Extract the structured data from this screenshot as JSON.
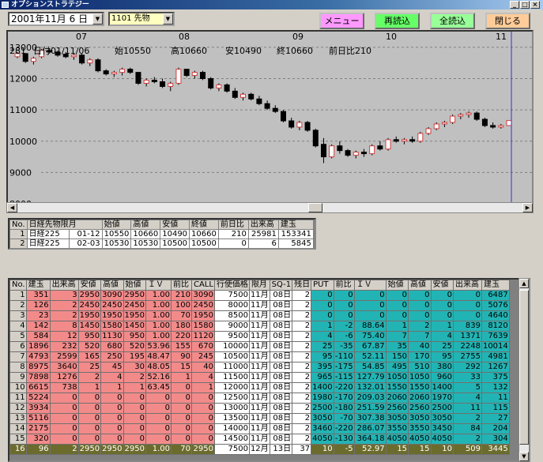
{
  "window": {
    "title": "オプションストラテジー",
    "min": "_",
    "max": "□",
    "close": "×"
  },
  "toolbar": {
    "date": "2001年11月 6 日",
    "instrument": "1101 先物",
    "buttons": [
      {
        "label": "メニュー",
        "color": "#ff99ff"
      },
      {
        "label": "再読込",
        "color": "#66ff66"
      },
      {
        "label": "全読込",
        "color": "#99ff99"
      },
      {
        "label": "閉じる",
        "color": "#ffcc99"
      }
    ]
  },
  "chart": {
    "x_ticks": [
      "07",
      "08",
      "09",
      "10",
      "11"
    ],
    "info": {
      "code": "281",
      "date": "日付01/11/06",
      "open": "始10550",
      "high": "高10660",
      "low": "安10490",
      "close": "終10660",
      "change": "前日比210"
    },
    "y_ticks": [
      "13000",
      "12000",
      "11000",
      "10000",
      "9000",
      "8000"
    ],
    "colors": {
      "up": "#ffffff",
      "down": "#000000",
      "grid": "#808080",
      "cursor": "#3333cc"
    }
  },
  "chart_data": {
    "type": "candlestick",
    "ylim": [
      8000,
      13200
    ],
    "x_ticks": [
      "07",
      "08",
      "09",
      "10",
      "11"
    ],
    "y_ticks": [
      13000,
      12000,
      11000,
      10000,
      9000,
      8000
    ],
    "candles": [
      [
        12700,
        12850,
        12650,
        12800
      ],
      [
        12800,
        12800,
        12500,
        12550
      ],
      [
        12550,
        12700,
        12450,
        12650
      ],
      [
        12700,
        12950,
        12650,
        12900
      ],
      [
        12900,
        12950,
        12800,
        12850
      ],
      [
        12850,
        12900,
        12700,
        12750
      ],
      [
        12780,
        12850,
        12650,
        12700
      ],
      [
        12700,
        12800,
        12600,
        12750
      ],
      [
        12750,
        12800,
        12450,
        12500
      ],
      [
        12500,
        12650,
        12400,
        12600
      ],
      [
        12600,
        12650,
        12200,
        12250
      ],
      [
        12250,
        12300,
        12100,
        12150
      ],
      [
        12150,
        12250,
        12050,
        12200
      ],
      [
        12200,
        12350,
        12100,
        12300
      ],
      [
        12300,
        12350,
        12150,
        12200
      ],
      [
        12200,
        12200,
        11800,
        11850
      ],
      [
        11850,
        12000,
        11750,
        11950
      ],
      [
        11950,
        12050,
        11850,
        11900
      ],
      [
        11900,
        12000,
        11700,
        11750
      ],
      [
        11750,
        11900,
        11600,
        11850
      ],
      [
        11850,
        12350,
        11800,
        12300
      ],
      [
        12300,
        12300,
        12050,
        12100
      ],
      [
        12100,
        12250,
        12000,
        12200
      ],
      [
        12200,
        12250,
        11950,
        12000
      ],
      [
        12000,
        12050,
        11650,
        11700
      ],
      [
        11700,
        11850,
        11600,
        11800
      ],
      [
        11800,
        11850,
        11550,
        11600
      ],
      [
        11600,
        11700,
        11350,
        11400
      ],
      [
        11400,
        11550,
        11300,
        11500
      ],
      [
        11500,
        11550,
        11300,
        11350
      ],
      [
        11350,
        11450,
        11150,
        11200
      ],
      [
        11200,
        11300,
        11000,
        11050
      ],
      [
        11050,
        11150,
        10900,
        10950
      ],
      [
        10950,
        11000,
        10600,
        10650
      ],
      [
        10650,
        10750,
        10400,
        10450
      ],
      [
        10450,
        10650,
        10350,
        10600
      ],
      [
        10600,
        10650,
        10300,
        10350
      ],
      [
        10350,
        10400,
        9800,
        9850
      ],
      [
        9900,
        10100,
        9300,
        9500
      ],
      [
        9500,
        9900,
        9450,
        9850
      ],
      [
        9850,
        10000,
        9600,
        9700
      ],
      [
        9700,
        9750,
        9500,
        9550
      ],
      [
        9550,
        9700,
        9450,
        9650
      ],
      [
        9650,
        9750,
        9500,
        9600
      ],
      [
        9600,
        9900,
        9550,
        9850
      ],
      [
        9850,
        10000,
        9700,
        9750
      ],
      [
        9750,
        10100,
        9700,
        10050
      ],
      [
        10050,
        10150,
        9950,
        10000
      ],
      [
        10000,
        10100,
        9900,
        10050
      ],
      [
        10050,
        10150,
        9950,
        10000
      ],
      [
        10000,
        10300,
        9950,
        10250
      ],
      [
        10250,
        10450,
        10200,
        10400
      ],
      [
        10400,
        10600,
        10350,
        10550
      ],
      [
        10550,
        10650,
        10450,
        10600
      ],
      [
        10600,
        10850,
        10550,
        10800
      ],
      [
        10800,
        10900,
        10700,
        10850
      ],
      [
        10850,
        10950,
        10750,
        10900
      ],
      [
        10900,
        10950,
        10650,
        10700
      ],
      [
        10700,
        10750,
        10450,
        10500
      ],
      [
        10500,
        10600,
        10400,
        10450
      ],
      [
        10450,
        10550,
        10400,
        10500
      ],
      [
        10500,
        10660,
        10490,
        10660
      ]
    ],
    "series": [
      {
        "name": "日経225先物",
        "values": []
      }
    ]
  },
  "futures": {
    "headers": [
      "No.",
      "日経先物限月",
      "始値",
      "高値",
      "安値",
      "終値",
      "前日比",
      "出来高",
      "建玉"
    ],
    "rows": [
      [
        "1",
        "日経225",
        "01-12",
        "10550",
        "10660",
        "10490",
        "10660",
        "210",
        "25981",
        "153341"
      ],
      [
        "2",
        "日経225",
        "02-03",
        "10530",
        "10530",
        "10500",
        "10500",
        "0",
        "6",
        "5845"
      ]
    ]
  },
  "options": {
    "headers": [
      "No.",
      "建玉",
      "出来高",
      "安値",
      "高値",
      "始値",
      "ＩＶ",
      "前比",
      "CALL",
      "行使価格",
      "限月",
      "SQ-1",
      "残日",
      "PUT",
      "前比",
      "ＩＶ",
      "始値",
      "高値",
      "安値",
      "出来高",
      "建玉"
    ],
    "rows": [
      [
        "1",
        "351",
        "3",
        "2950",
        "3090",
        "2950",
        "1.00",
        "210",
        "3090",
        "7500",
        "11月",
        "08日",
        "2",
        "0",
        "0",
        "0",
        "0",
        "0",
        "0",
        "0",
        "6487"
      ],
      [
        "2",
        "126",
        "2",
        "2450",
        "2450",
        "2450",
        "1.00",
        "100",
        "2450",
        "8000",
        "11月",
        "08日",
        "2",
        "0",
        "0",
        "0",
        "0",
        "0",
        "0",
        "0",
        "5076"
      ],
      [
        "3",
        "23",
        "2",
        "1950",
        "1950",
        "1950",
        "1.00",
        "70",
        "1950",
        "8500",
        "11月",
        "08日",
        "2",
        "0",
        "0",
        "0",
        "0",
        "0",
        "0",
        "0",
        "4640"
      ],
      [
        "4",
        "142",
        "8",
        "1450",
        "1580",
        "1450",
        "1.00",
        "180",
        "1580",
        "9000",
        "11月",
        "08日",
        "2",
        "1",
        "-2",
        "88.64",
        "1",
        "2",
        "1",
        "839",
        "8120"
      ],
      [
        "5",
        "584",
        "12",
        "950",
        "1130",
        "950",
        "1.00",
        "220",
        "1120",
        "9500",
        "11月",
        "08日",
        "2",
        "4",
        "-6",
        "75.40",
        "7",
        "7",
        "4",
        "1371",
        "7639"
      ],
      [
        "6",
        "1896",
        "232",
        "520",
        "680",
        "520",
        "53.96",
        "155",
        "670",
        "10000",
        "11月",
        "08日",
        "2",
        "25",
        "-35",
        "67.87",
        "35",
        "40",
        "25",
        "2248",
        "10014"
      ],
      [
        "7",
        "4793",
        "2599",
        "165",
        "250",
        "195",
        "48.47",
        "90",
        "245",
        "10500",
        "11月",
        "08日",
        "2",
        "95",
        "-110",
        "52.11",
        "150",
        "170",
        "95",
        "2755",
        "4981"
      ],
      [
        "8",
        "8975",
        "3640",
        "25",
        "45",
        "30",
        "48.05",
        "15",
        "40",
        "11000",
        "11月",
        "08日",
        "2",
        "395",
        "-175",
        "54.85",
        "495",
        "510",
        "380",
        "292",
        "1267"
      ],
      [
        "9",
        "7898",
        "1276",
        "2",
        "4",
        "2",
        "52.16",
        "1",
        "4",
        "11500",
        "11月",
        "08日",
        "2",
        "965",
        "-115",
        "127.79",
        "1050",
        "1050",
        "960",
        "33",
        "375"
      ],
      [
        "10",
        "6615",
        "738",
        "1",
        "1",
        "1",
        "63.45",
        "0",
        "1",
        "12000",
        "11月",
        "08日",
        "2",
        "1400",
        "-220",
        "132.01",
        "1550",
        "1550",
        "1400",
        "5",
        "132"
      ],
      [
        "11",
        "5224",
        "0",
        "0",
        "0",
        "0",
        "0",
        "0",
        "0",
        "12500",
        "11月",
        "08日",
        "2",
        "1980",
        "-170",
        "209.03",
        "2060",
        "2060",
        "1970",
        "4",
        "11"
      ],
      [
        "12",
        "3934",
        "0",
        "0",
        "0",
        "0",
        "0",
        "0",
        "0",
        "13000",
        "11月",
        "08日",
        "2",
        "2500",
        "-180",
        "251.59",
        "2560",
        "2560",
        "2500",
        "11",
        "115"
      ],
      [
        "13",
        "5116",
        "0",
        "0",
        "0",
        "0",
        "0",
        "0",
        "0",
        "13500",
        "11月",
        "08日",
        "2",
        "3050",
        "-70",
        "307.38",
        "3050",
        "3050",
        "3050",
        "2",
        "27"
      ],
      [
        "14",
        "2175",
        "0",
        "0",
        "0",
        "0",
        "0",
        "0",
        "0",
        "14000",
        "11月",
        "08日",
        "2",
        "3460",
        "-220",
        "286.07",
        "3550",
        "3550",
        "3450",
        "84",
        "204"
      ],
      [
        "15",
        "320",
        "0",
        "0",
        "0",
        "0",
        "0",
        "0",
        "0",
        "14500",
        "11月",
        "08日",
        "2",
        "4050",
        "-130",
        "364.18",
        "4050",
        "4050",
        "4050",
        "2",
        "304"
      ],
      [
        "16",
        "96",
        "2",
        "2950",
        "2950",
        "2950",
        "1.00",
        "70",
        "2950",
        "7500",
        "12月",
        "13日",
        "37",
        "10",
        "-5",
        "52.97",
        "15",
        "15",
        "10",
        "509",
        "3445"
      ]
    ]
  }
}
